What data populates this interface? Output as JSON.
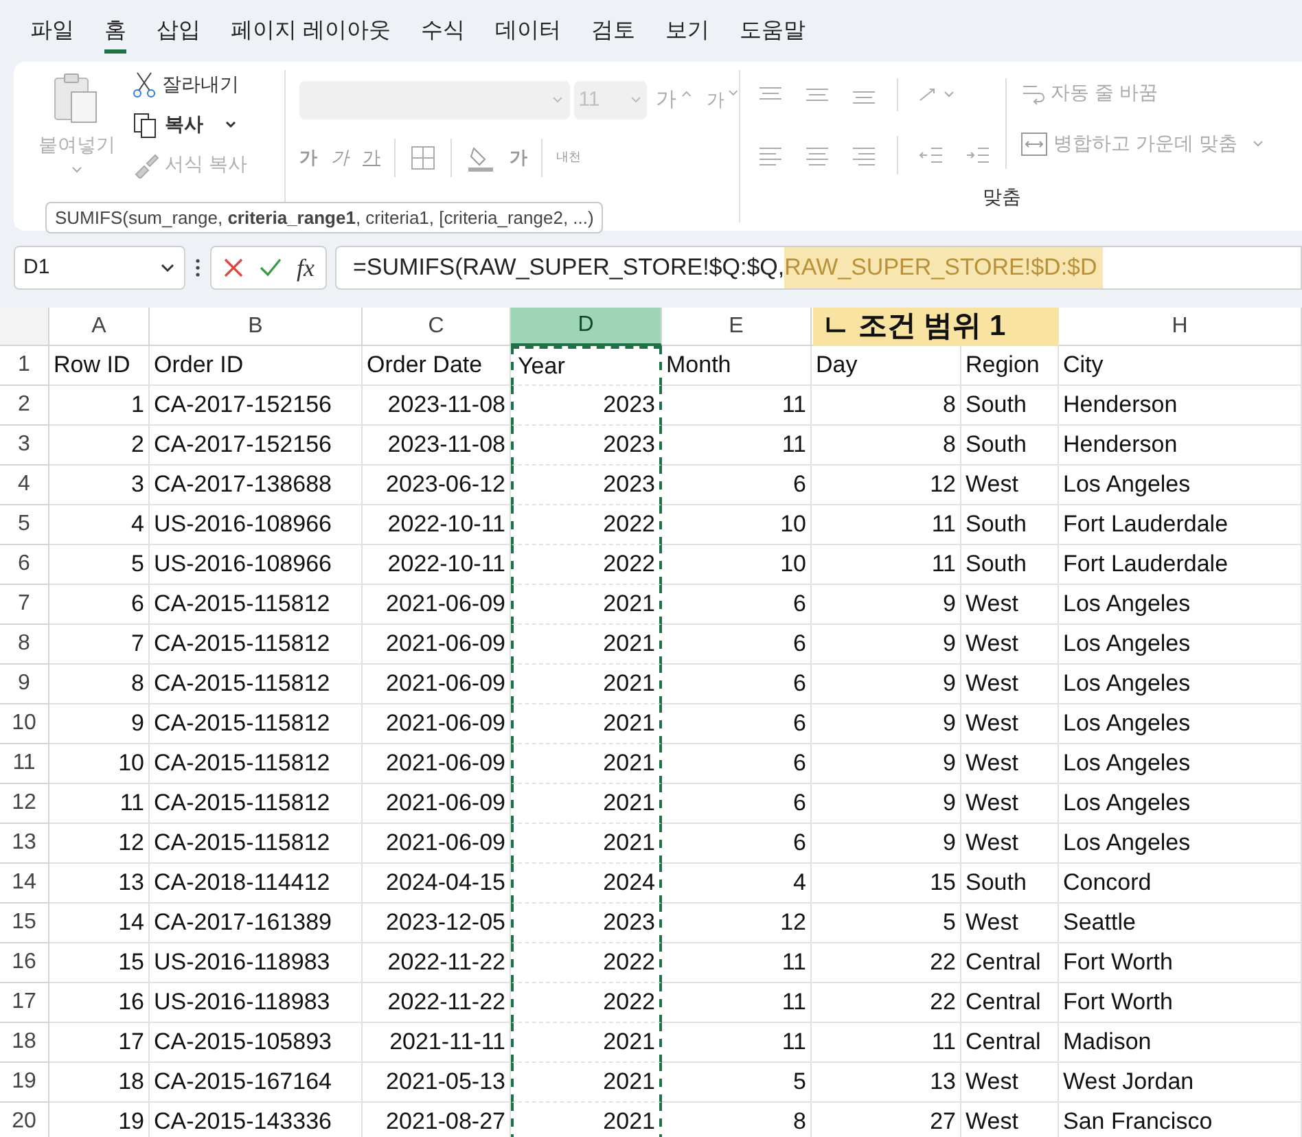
{
  "menu_tabs": [
    {
      "label": "파일",
      "selected": false
    },
    {
      "label": "홈",
      "selected": true
    },
    {
      "label": "삽입",
      "selected": false
    },
    {
      "label": "페이지 레이아웃",
      "selected": false
    },
    {
      "label": "수식",
      "selected": false
    },
    {
      "label": "데이터",
      "selected": false
    },
    {
      "label": "검토",
      "selected": false
    },
    {
      "label": "보기",
      "selected": false
    },
    {
      "label": "도움말",
      "selected": false
    }
  ],
  "clipboard": {
    "paste": "붙여넣기",
    "cut": "잘라내기",
    "copy": "복사",
    "format_painter": "서식 복사"
  },
  "font": {
    "size": "11",
    "grow": "가",
    "shrink": "가",
    "bold": "가",
    "italic": "가",
    "underline": "가",
    "font_color": "가",
    "phonetic": "내천"
  },
  "alignment": {
    "wrap_text": "자동 줄 바꿈",
    "merge": "병합하고 가운데 맞춤",
    "group_label": "맞춤"
  },
  "tooltip": "SUMIFS(sum_range, **criteria_range1**, criteria1, [criteria_range2, ...)",
  "name_box": "D1",
  "function_button": "fx",
  "formula": [
    {
      "text": "=SUMIFS(RAW_SUPER_STORE!$Q:$Q,",
      "highlighted": false
    },
    {
      "text": "RAW_SUPER_STORE!$D:$D",
      "highlighted": true
    }
  ],
  "annotation": "ㄴ 조건 범위 1",
  "columns": [
    {
      "label": "A",
      "kind": "number",
      "selected": false
    },
    {
      "label": "B",
      "kind": "text",
      "selected": false
    },
    {
      "label": "C",
      "kind": "number",
      "selected": false
    },
    {
      "label": "D",
      "kind": "number",
      "selected": true
    },
    {
      "label": "E",
      "kind": "number",
      "selected": false
    },
    {
      "kind": "number"
    },
    {
      "kind": "text"
    },
    {
      "label": "H",
      "kind": "text",
      "selected": false
    }
  ],
  "header_row": {
    "number": "1",
    "cells": [
      "Row ID",
      "Order ID",
      "Order Date",
      "Year",
      "Month",
      "Day",
      "Region",
      "City"
    ]
  },
  "rows": [
    {
      "number": "2",
      "cells": [
        "1",
        "CA-2017-152156",
        "2023-11-08",
        "2023",
        "11",
        "8",
        "South",
        "Henderson"
      ]
    },
    {
      "number": "3",
      "cells": [
        "2",
        "CA-2017-152156",
        "2023-11-08",
        "2023",
        "11",
        "8",
        "South",
        "Henderson"
      ]
    },
    {
      "number": "4",
      "cells": [
        "3",
        "CA-2017-138688",
        "2023-06-12",
        "2023",
        "6",
        "12",
        "West",
        "Los Angeles"
      ]
    },
    {
      "number": "5",
      "cells": [
        "4",
        "US-2016-108966",
        "2022-10-11",
        "2022",
        "10",
        "11",
        "South",
        "Fort Lauderdale"
      ]
    },
    {
      "number": "6",
      "cells": [
        "5",
        "US-2016-108966",
        "2022-10-11",
        "2022",
        "10",
        "11",
        "South",
        "Fort Lauderdale"
      ]
    },
    {
      "number": "7",
      "cells": [
        "6",
        "CA-2015-115812",
        "2021-06-09",
        "2021",
        "6",
        "9",
        "West",
        "Los Angeles"
      ]
    },
    {
      "number": "8",
      "cells": [
        "7",
        "CA-2015-115812",
        "2021-06-09",
        "2021",
        "6",
        "9",
        "West",
        "Los Angeles"
      ]
    },
    {
      "number": "9",
      "cells": [
        "8",
        "CA-2015-115812",
        "2021-06-09",
        "2021",
        "6",
        "9",
        "West",
        "Los Angeles"
      ]
    },
    {
      "number": "10",
      "cells": [
        "9",
        "CA-2015-115812",
        "2021-06-09",
        "2021",
        "6",
        "9",
        "West",
        "Los Angeles"
      ]
    },
    {
      "number": "11",
      "cells": [
        "10",
        "CA-2015-115812",
        "2021-06-09",
        "2021",
        "6",
        "9",
        "West",
        "Los Angeles"
      ]
    },
    {
      "number": "12",
      "cells": [
        "11",
        "CA-2015-115812",
        "2021-06-09",
        "2021",
        "6",
        "9",
        "West",
        "Los Angeles"
      ]
    },
    {
      "number": "13",
      "cells": [
        "12",
        "CA-2015-115812",
        "2021-06-09",
        "2021",
        "6",
        "9",
        "West",
        "Los Angeles"
      ]
    },
    {
      "number": "14",
      "cells": [
        "13",
        "CA-2018-114412",
        "2024-04-15",
        "2024",
        "4",
        "15",
        "South",
        "Concord"
      ]
    },
    {
      "number": "15",
      "cells": [
        "14",
        "CA-2017-161389",
        "2023-12-05",
        "2023",
        "12",
        "5",
        "West",
        "Seattle"
      ]
    },
    {
      "number": "16",
      "cells": [
        "15",
        "US-2016-118983",
        "2022-11-22",
        "2022",
        "11",
        "22",
        "Central",
        "Fort Worth"
      ]
    },
    {
      "number": "17",
      "cells": [
        "16",
        "US-2016-118983",
        "2022-11-22",
        "2022",
        "11",
        "22",
        "Central",
        "Fort Worth"
      ]
    },
    {
      "number": "18",
      "cells": [
        "17",
        "CA-2015-105893",
        "2021-11-11",
        "2021",
        "11",
        "11",
        "Central",
        "Madison"
      ]
    },
    {
      "number": "19",
      "cells": [
        "18",
        "CA-2015-167164",
        "2021-05-13",
        "2021",
        "5",
        "13",
        "West",
        "West Jordan"
      ]
    },
    {
      "number": "20",
      "cells": [
        "19",
        "CA-2015-143336",
        "2021-08-27",
        "2021",
        "8",
        "27",
        "West",
        "San Francisco"
      ]
    }
  ]
}
